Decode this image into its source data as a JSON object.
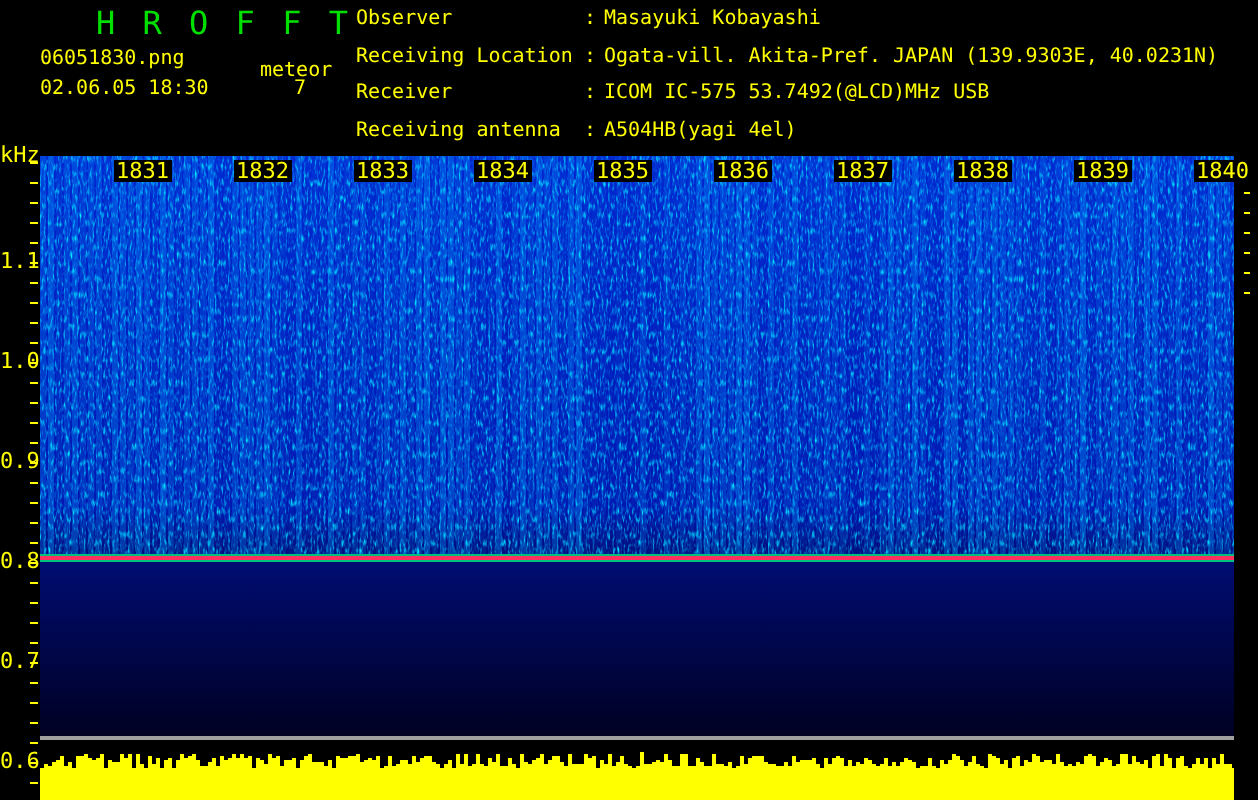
{
  "app": {
    "title": "H R O F F T"
  },
  "file": {
    "name": "06051830.png",
    "datetime": "02.06.05 18:30"
  },
  "meteor": {
    "label": "meteor",
    "count": "7"
  },
  "station": [
    {
      "label": "Observer",
      "separator": ":",
      "value": "Masayuki Kobayashi"
    },
    {
      "label": "Receiving Location",
      "separator": ":",
      "value": "Ogata-vill. Akita-Pref. JAPAN (139.9303E, 40.0231N)"
    },
    {
      "label": "Receiver",
      "separator": ":",
      "value": "ICOM IC-575 53.7492(@LCD)MHz USB"
    },
    {
      "label": "Receiving antenna",
      "separator": ":",
      "value": "A504HB(yagi 4el)"
    }
  ],
  "spectrogram": {
    "y_unit": "kHz",
    "y_labels": [
      "1.1",
      "1.0",
      "0.9",
      "0.8",
      "0.7",
      "0.6"
    ],
    "time_labels": [
      "1831",
      "1832",
      "1833",
      "1834",
      "1835",
      "1836",
      "1837",
      "1838",
      "1839",
      "1840"
    ]
  }
}
